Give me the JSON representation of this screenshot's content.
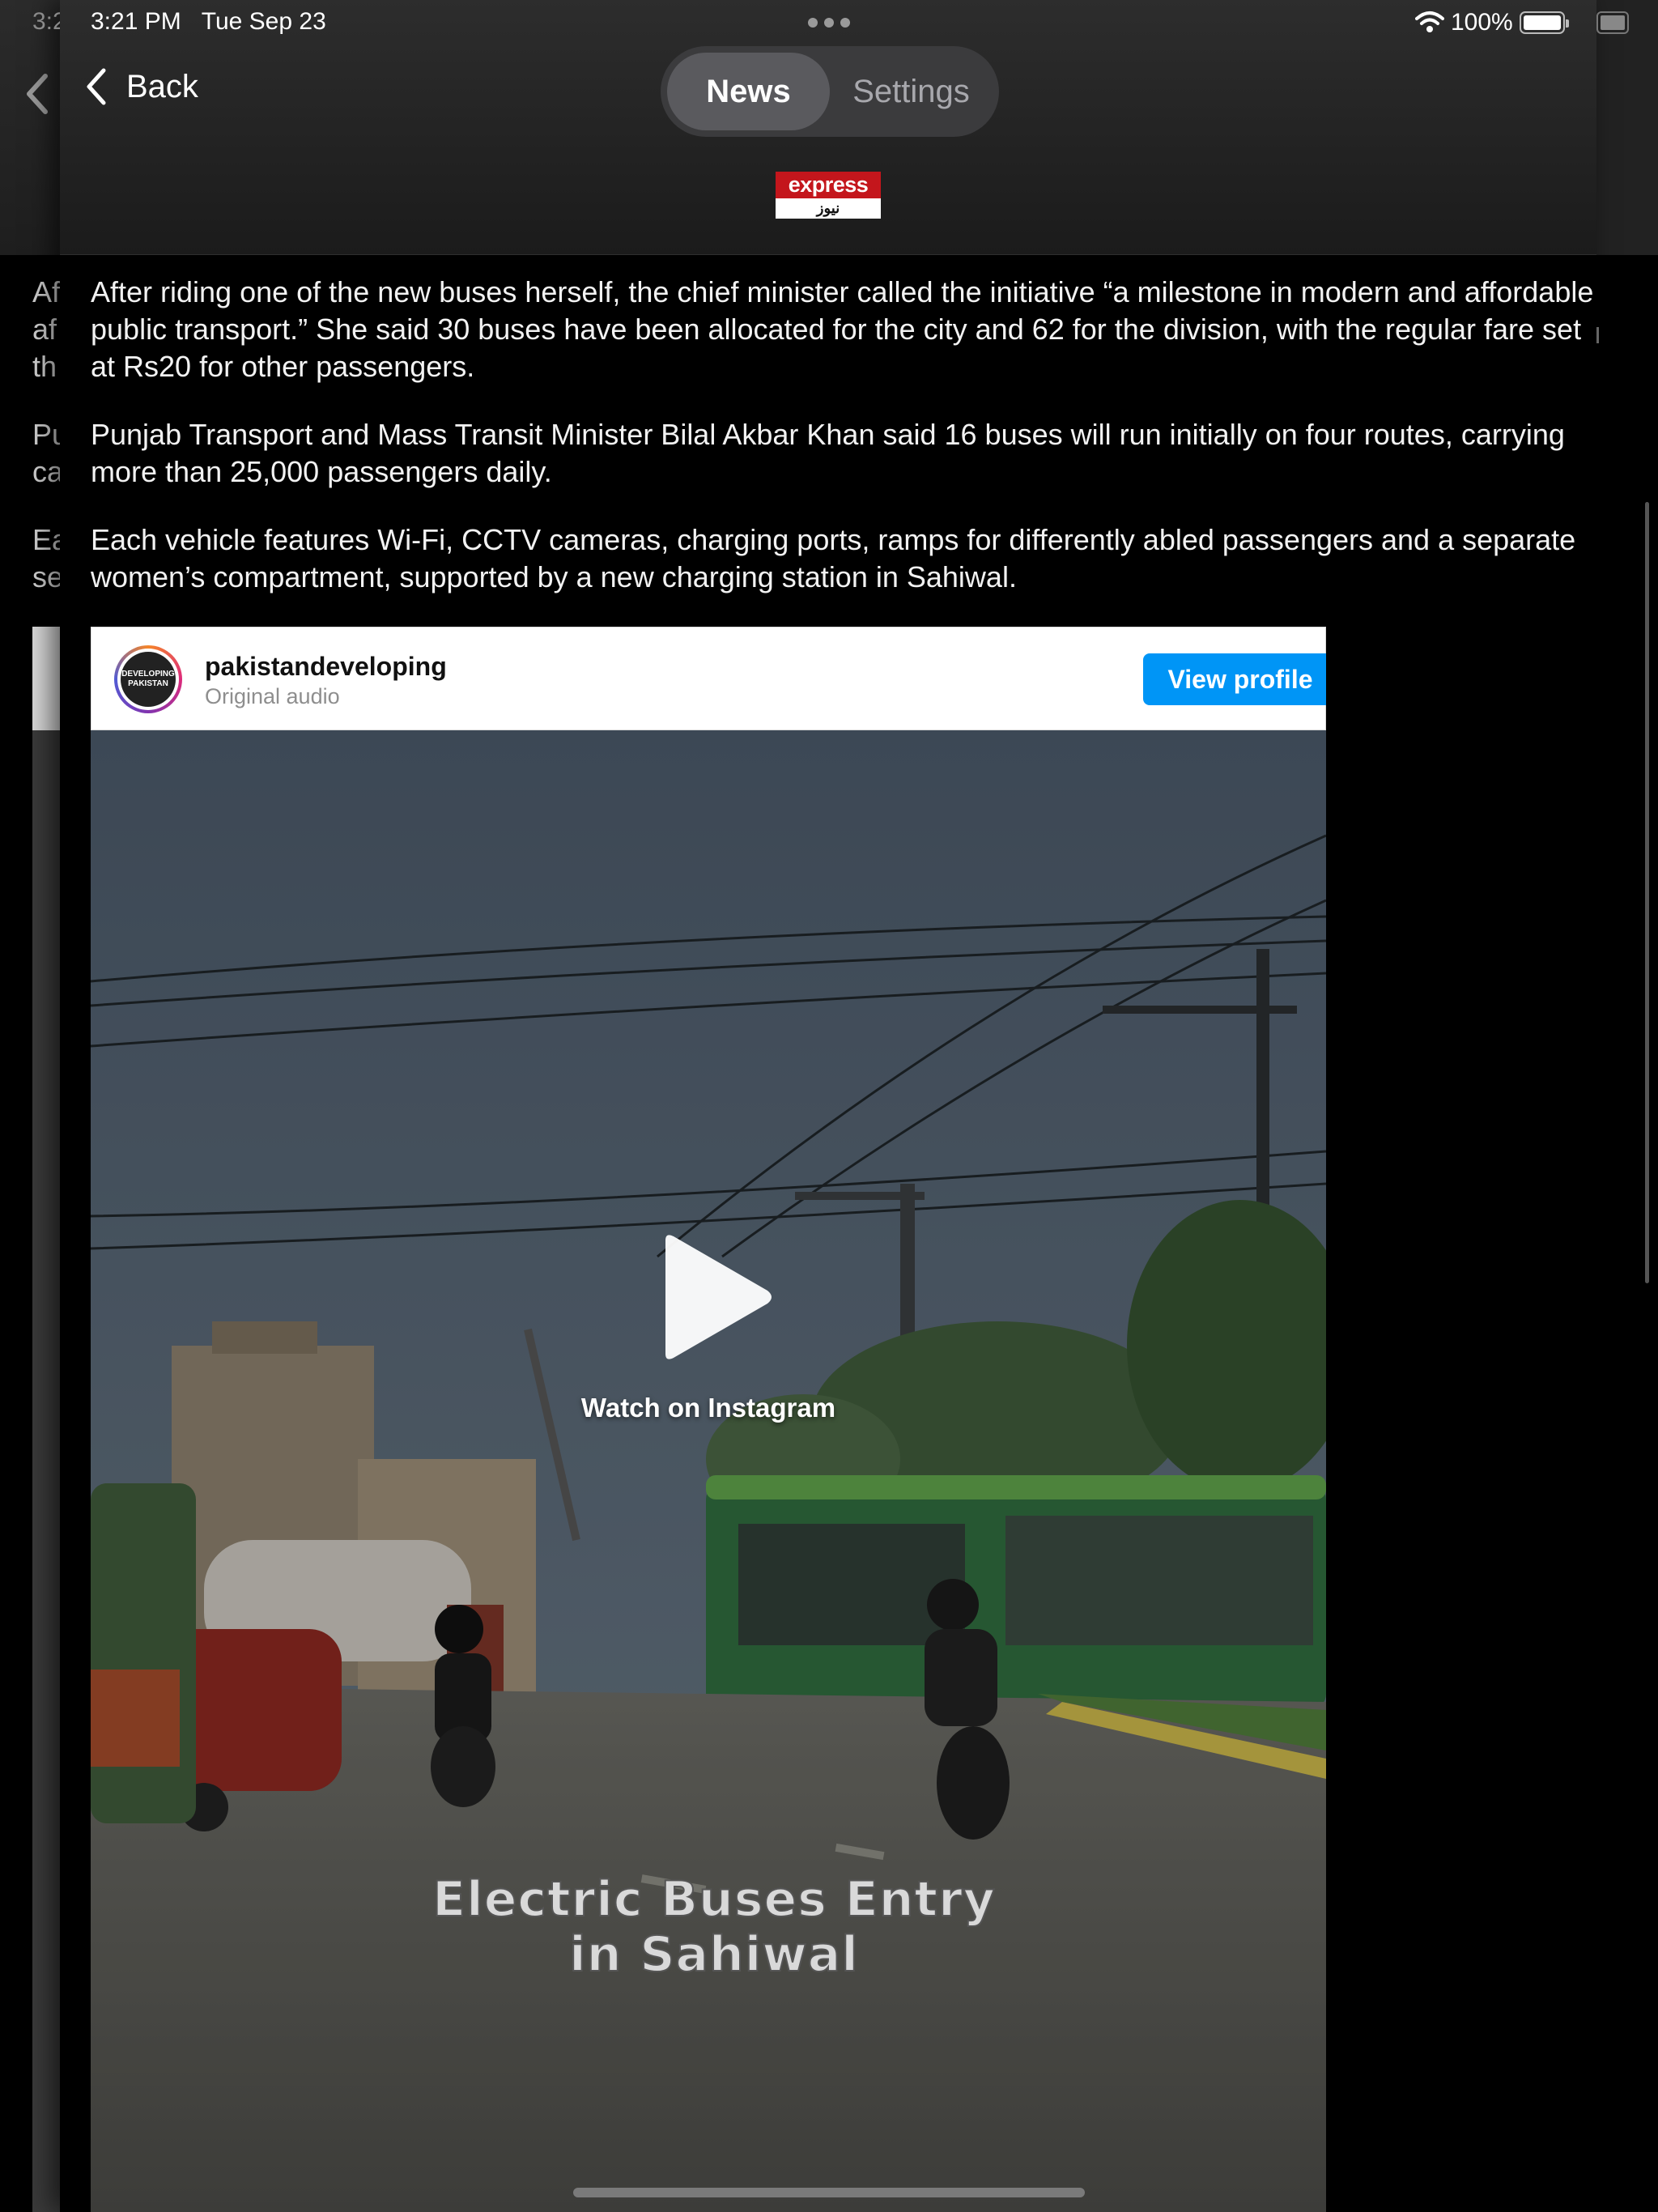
{
  "status_bar": {
    "time": "3:21 PM",
    "date": "Tue Sep 23",
    "ghost_time": "3:2",
    "battery_percent": "100%",
    "battery_level": 1.0
  },
  "nav": {
    "back_label": "Back",
    "tabs": [
      {
        "label": "News",
        "active": true
      },
      {
        "label": "Settings",
        "active": false
      }
    ]
  },
  "publisher": {
    "name_top": "express",
    "name_bottom": "نیوز",
    "brand_color": "#c4161c"
  },
  "article": {
    "paragraphs": [
      "After riding one of the new buses herself, the chief minister called the initiative “a milestone in modern and affordable public transport.” She said 30 buses have been allocated for the city and 62 for the division, with the regular fare set at Rs20 for other passengers.",
      "Punjab Transport and Mass Transit Minister Bilal Akbar Khan said 16 buses will run initially on four routes, carrying more than 25,000 passengers daily.",
      "Each vehicle features Wi-Fi, CCTV cameras, charging ports, ramps for differently abled passengers and a separate women’s compartment, supported by a new charging station in Sahiwal."
    ],
    "ghost_lines": [
      "Af",
      "af",
      "th",
      "Pu",
      "ca",
      "Ea",
      "se"
    ]
  },
  "instagram_embed": {
    "username": "pakistandeveloping",
    "subtitle": "Original audio",
    "avatar_text_1": "DEVELOPING",
    "avatar_text_2": "PAKISTAN",
    "view_profile_label": "View profile",
    "button_color": "#0095f6",
    "watch_label": "Watch on Instagram",
    "video_caption_line1": "Electric Buses Entry",
    "video_caption_line2": "in Sahiwal"
  }
}
